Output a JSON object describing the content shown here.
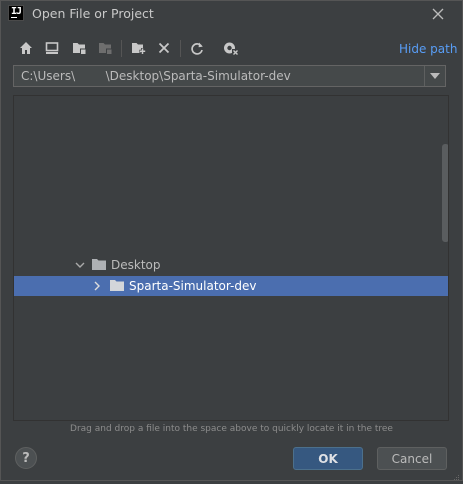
{
  "window": {
    "title": "Open File or Project",
    "app_icon_text": "IJ"
  },
  "toolbar": {
    "icons": [
      "home-icon",
      "desktop-icon",
      "project-folder-icon",
      "module-folder-icon",
      "new-folder-icon",
      "delete-icon",
      "refresh-icon",
      "show-hidden-icon"
    ],
    "hide_path_label": "Hide path"
  },
  "path": {
    "value": "C:\\Users\\        \\Desktop\\Sparta-Simulator-dev"
  },
  "tree": {
    "items": [
      {
        "label": "Desktop",
        "expanded": true,
        "selected": false
      },
      {
        "label": "Sparta-Simulator-dev",
        "expanded": false,
        "selected": true
      }
    ]
  },
  "hint": "Drag and drop a file into the space above to quickly locate it in the tree",
  "buttons": {
    "help": "?",
    "ok": "OK",
    "cancel": "Cancel"
  },
  "colors": {
    "background": "#3c3f41",
    "selection": "#4b6eaf",
    "link": "#589df6",
    "ok_button": "#365880"
  }
}
